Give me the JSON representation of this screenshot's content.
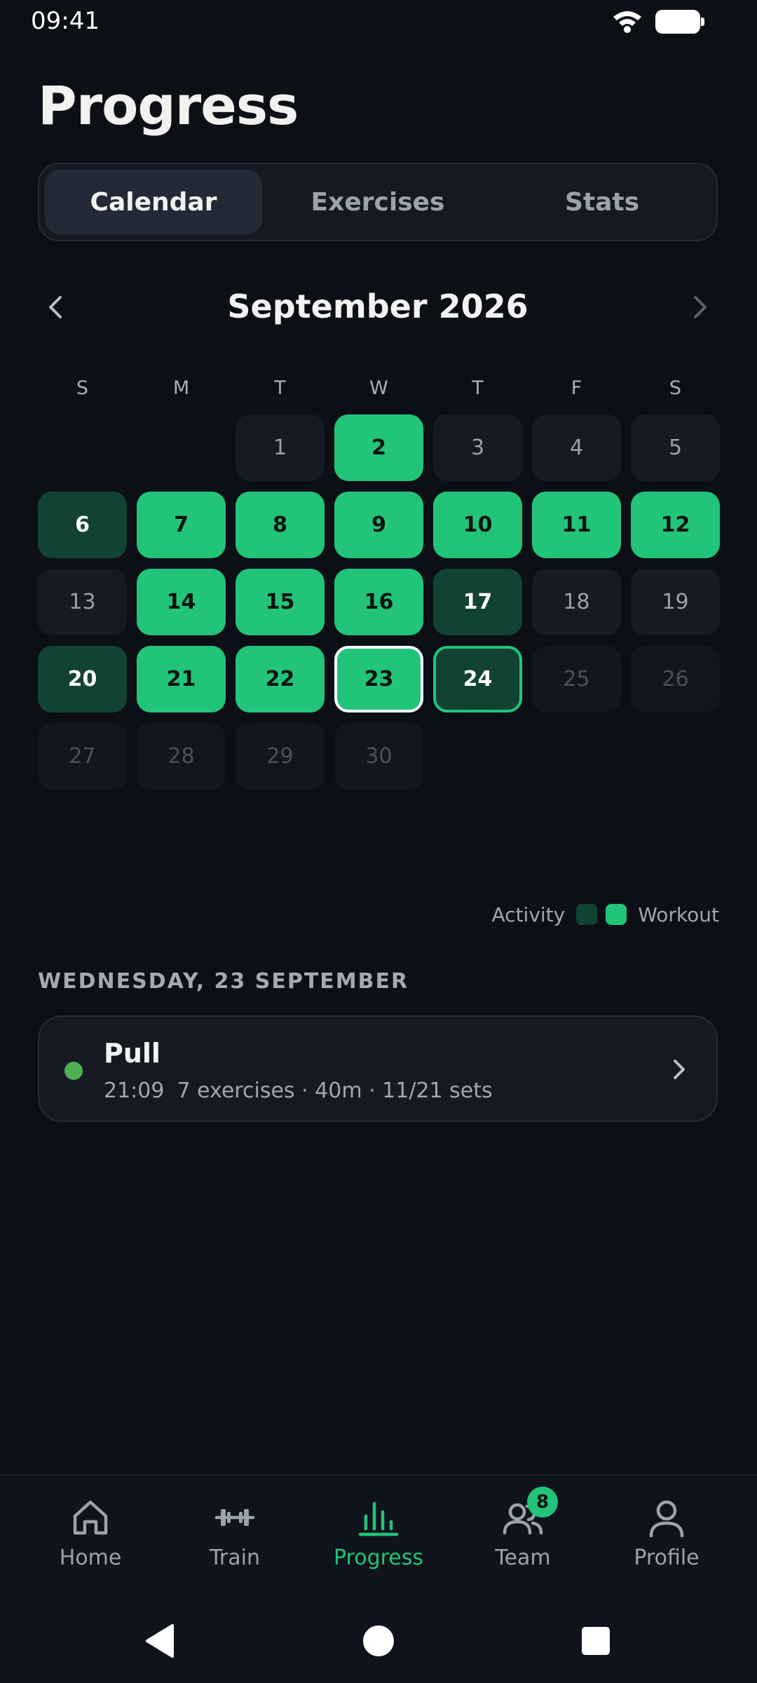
{
  "status_bar": {
    "time": "09:41"
  },
  "page": {
    "title": "Progress"
  },
  "tabs": [
    {
      "label": "Calendar",
      "active": true
    },
    {
      "label": "Exercises",
      "active": false
    },
    {
      "label": "Stats",
      "active": false
    }
  ],
  "calendar": {
    "month_title": "September 2026",
    "weekdays": [
      "S",
      "M",
      "T",
      "W",
      "T",
      "F",
      "S"
    ],
    "days": [
      {
        "d": "1",
        "state": "plain"
      },
      {
        "d": "2",
        "state": "workout"
      },
      {
        "d": "3",
        "state": "plain"
      },
      {
        "d": "4",
        "state": "plain"
      },
      {
        "d": "5",
        "state": "plain"
      },
      {
        "d": "6",
        "state": "activity"
      },
      {
        "d": "7",
        "state": "workout"
      },
      {
        "d": "8",
        "state": "workout"
      },
      {
        "d": "9",
        "state": "workout"
      },
      {
        "d": "10",
        "state": "workout"
      },
      {
        "d": "11",
        "state": "workout"
      },
      {
        "d": "12",
        "state": "workout"
      },
      {
        "d": "13",
        "state": "plain"
      },
      {
        "d": "14",
        "state": "workout"
      },
      {
        "d": "15",
        "state": "workout"
      },
      {
        "d": "16",
        "state": "workout"
      },
      {
        "d": "17",
        "state": "activity"
      },
      {
        "d": "18",
        "state": "plain"
      },
      {
        "d": "19",
        "state": "plain"
      },
      {
        "d": "20",
        "state": "activity"
      },
      {
        "d": "21",
        "state": "workout"
      },
      {
        "d": "22",
        "state": "workout"
      },
      {
        "d": "23",
        "state": "workout",
        "selected": true
      },
      {
        "d": "24",
        "state": "activity",
        "today": true
      },
      {
        "d": "25",
        "state": "future"
      },
      {
        "d": "26",
        "state": "future"
      },
      {
        "d": "27",
        "state": "future"
      },
      {
        "d": "28",
        "state": "future"
      },
      {
        "d": "29",
        "state": "future"
      },
      {
        "d": "30",
        "state": "future"
      }
    ]
  },
  "legend": {
    "activity_label": "Activity",
    "workout_label": "Workout"
  },
  "selected_day": {
    "heading": "WEDNESDAY, 23 SEPTEMBER",
    "workout": {
      "name": "Pull",
      "time": "21:09",
      "summary": "7 exercises · 40m · 11/21 sets"
    }
  },
  "bottom_nav": [
    {
      "label": "Home",
      "icon": "home-icon",
      "active": false
    },
    {
      "label": "Train",
      "icon": "dumbbell-icon",
      "active": false
    },
    {
      "label": "Progress",
      "icon": "chart-icon",
      "active": true
    },
    {
      "label": "Team",
      "icon": "team-icon",
      "active": false,
      "badge": "8"
    },
    {
      "label": "Profile",
      "icon": "profile-icon",
      "active": false
    }
  ],
  "colors": {
    "background": "#0c0f15",
    "workout": "#22c47a",
    "activity": "#124233",
    "status_dot": "#4caf50"
  }
}
